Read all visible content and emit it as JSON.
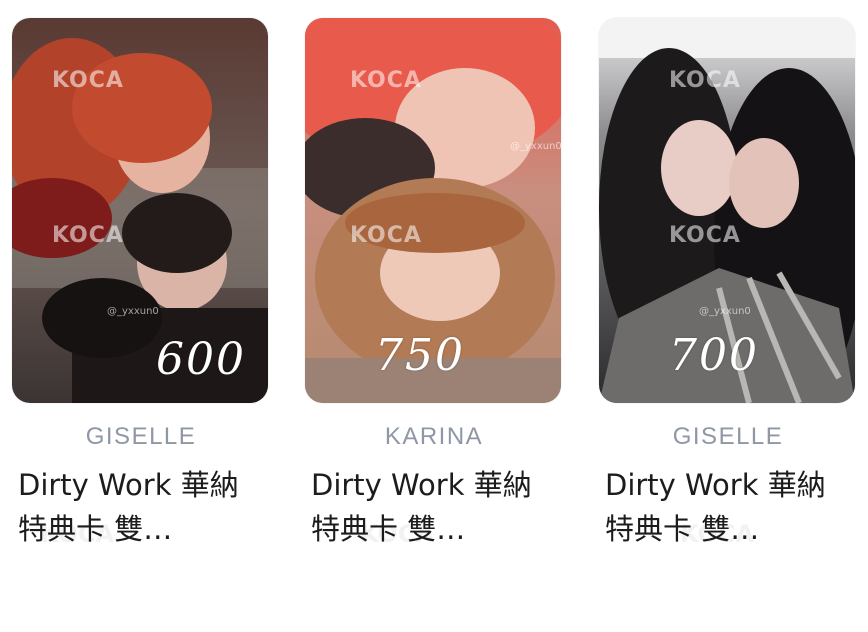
{
  "watermark": {
    "brand": "KOCA",
    "handle": "@_yxxun0"
  },
  "cards": [
    {
      "member": "GISELLE",
      "title": "Dirty Work 華納 特典卡 雙…",
      "price_note": "600",
      "photo_desc_icon": "photocard-image"
    },
    {
      "member": "KARINA",
      "title": "Dirty Work 華納 特典卡 雙…",
      "price_note": "750",
      "photo_desc_icon": "photocard-image"
    },
    {
      "member": "GISELLE",
      "title": "Dirty Work 華納 特典卡 雙…",
      "price_note": "700",
      "photo_desc_icon": "photocard-image"
    }
  ]
}
